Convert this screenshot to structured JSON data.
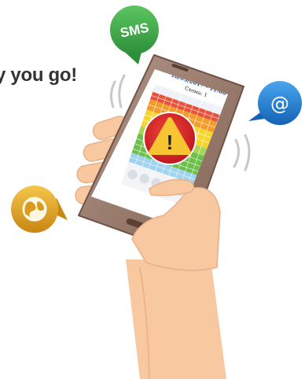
{
  "tagline": "y you go!",
  "bubbles": {
    "sms": {
      "label": "SMS",
      "color": "#3aa84a",
      "icon": "sms-bubble-icon"
    },
    "email": {
      "label": "@",
      "color": "#1f7fd6",
      "icon": "at-bubble-icon"
    },
    "web": {
      "color": "#e7a91a",
      "icon": "globe-bubble-icon"
    }
  },
  "phone": {
    "screen_title": "18/05/2017 - 11:06",
    "screen_subtitle": "Схема: 1",
    "alert": {
      "color": "#e2262b",
      "icon": "warning-triangle-icon",
      "mark": "!"
    }
  },
  "colors": {
    "grid_red": "#e8523a",
    "grid_orange": "#f39c2b",
    "grid_yellow": "#f6d62e",
    "grid_green": "#6cc04a",
    "skin": "#f8c9a0",
    "phone_body": "#9c7d6f"
  }
}
